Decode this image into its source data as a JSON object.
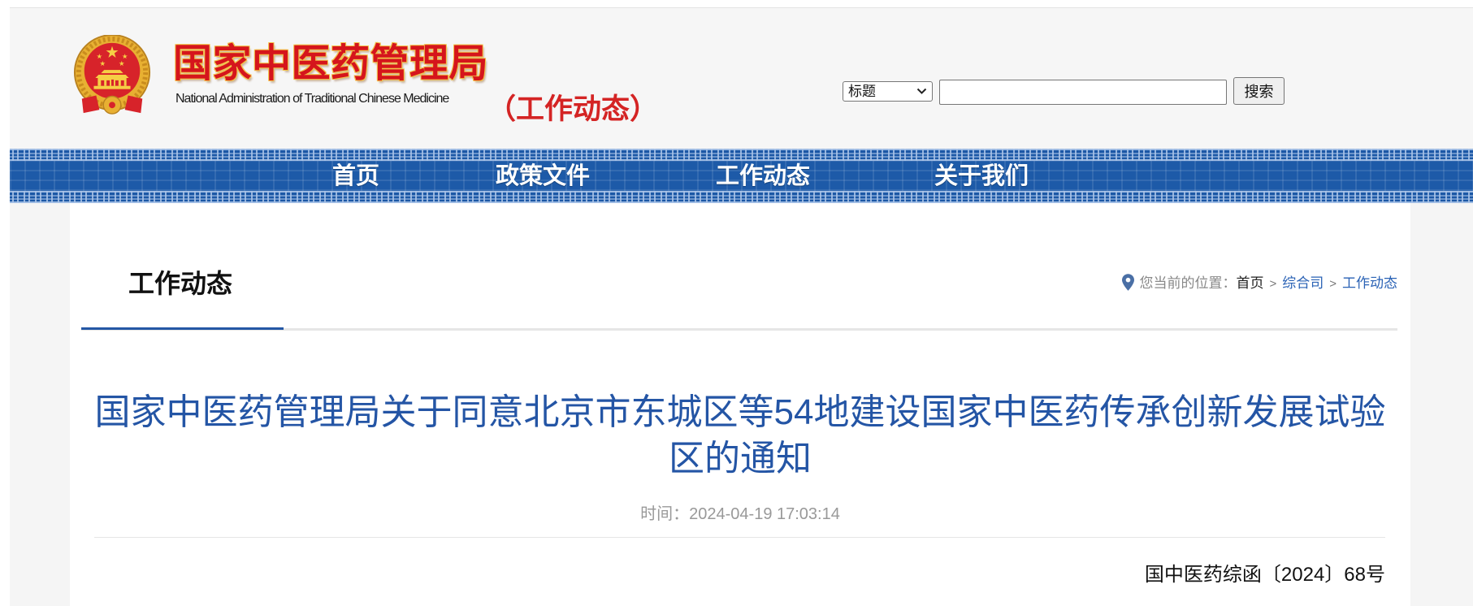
{
  "header": {
    "logo": {
      "org_name_cn": "国家中医药管理局",
      "org_name_en": "National Administration of Traditional Chinese Medicine",
      "emblem_icon": "national-emblem"
    },
    "section_tag": "（工作动态）",
    "search": {
      "field_select_value": "标题",
      "input_value": "",
      "button_label": "搜索"
    }
  },
  "nav": {
    "items": [
      {
        "label": "首页"
      },
      {
        "label": "政策文件"
      },
      {
        "label": "工作动态"
      },
      {
        "label": "关于我们"
      }
    ]
  },
  "content": {
    "section_title": "工作动态",
    "breadcrumb": {
      "icon": "location-pin-icon",
      "prefix": "您当前的位置：",
      "separator": ">",
      "items": [
        {
          "label": "首页"
        },
        {
          "label": "综合司"
        },
        {
          "label": "工作动态"
        }
      ]
    },
    "article": {
      "title": "国家中医药管理局关于同意北京市东城区等54地建设国家中医药传承创新发展试验区的通知",
      "time_label": "时间：",
      "time_value": "2024-04-19 17:03:14",
      "doc_number": "国中医药综函〔2024〕68号"
    }
  },
  "colors": {
    "logo_red": "#d5151c",
    "nav_blue": "#1c58a6",
    "title_blue": "#2455a5",
    "link_blue": "#2a62b5",
    "underline_blue": "#2457a5",
    "page_background": "#f5f5f5"
  }
}
